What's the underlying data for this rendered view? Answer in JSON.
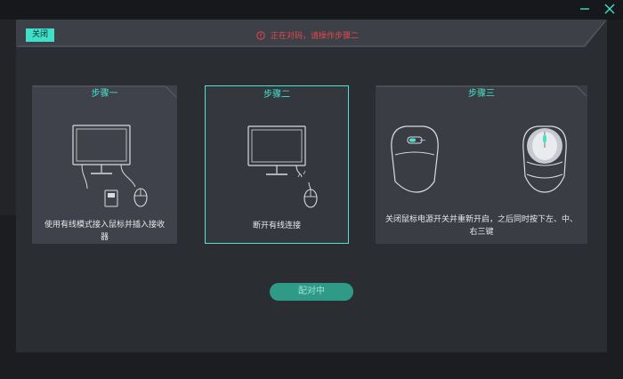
{
  "window": {
    "minimize_icon": "minimize-icon",
    "close_icon": "close-icon"
  },
  "dialog": {
    "close_label": "关闭",
    "status_text": "正在对码，请操作步骤二",
    "status_color": "#e5484d",
    "accent_color": "#45e3cc",
    "pair_button_label": "配对中"
  },
  "steps": [
    {
      "title": "步骤一",
      "text": "使用有线模式接入鼠标并插入接收器"
    },
    {
      "title": "步骤二",
      "text": "断开有线连接"
    },
    {
      "title": "步骤三",
      "text": "关闭鼠标电源开关并重新开启，之后同时按下左、中、右三键"
    }
  ]
}
